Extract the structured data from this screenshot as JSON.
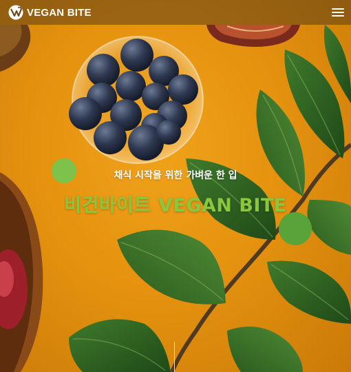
{
  "header": {
    "logo_text": "VEGAN BITE",
    "logo_icon": "vegan-bite-logo-mark",
    "menu_icon": "hamburger-menu-icon"
  },
  "hero": {
    "tagline": "채식 시작을 위한 가벼운 한 입",
    "title": "비건바이트 VEGAN BITE"
  },
  "colors": {
    "background_orange": "#e5920f",
    "title_green": "#8cc63f",
    "dot_green": "#7cc24b",
    "header_overlay": "#5c3e16"
  }
}
